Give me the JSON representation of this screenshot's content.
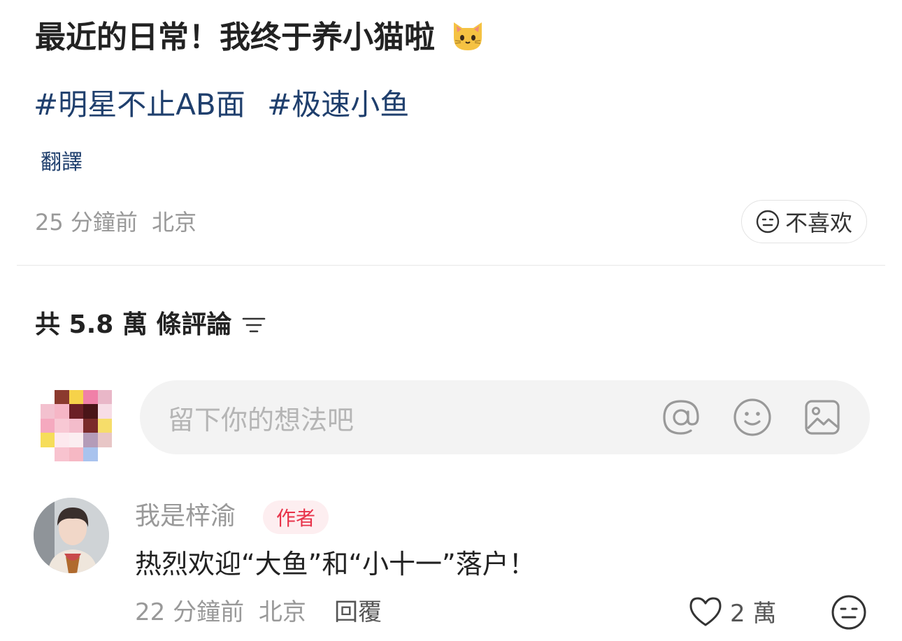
{
  "post": {
    "title": "最近的日常！我终于养小猫啦",
    "title_emoji": "cat-face-icon",
    "tags": [
      "#明星不止AB面",
      "#极速小鱼"
    ],
    "translate_label": "翻譯",
    "time": "25 分鐘前",
    "location": "北京",
    "dislike_label": "不喜欢"
  },
  "comments_header": {
    "label": "共 5.8 萬 條評論",
    "sort_icon": "sort-filter-icon"
  },
  "comment_input": {
    "placeholder": "留下你的想法吧",
    "icons": [
      "at-icon",
      "emoji-icon",
      "image-icon"
    ]
  },
  "comments": [
    {
      "author": "我是梓渝",
      "badge": "作者",
      "text": "热烈欢迎“大鱼”和“小十一”落户！",
      "time": "22 分鐘前",
      "location": "北京",
      "reply_label": "回覆",
      "likes": "2 萬"
    }
  ],
  "colors": {
    "tag_link": "#1f3f6d",
    "badge_text": "#e8334a",
    "badge_bg": "#fdeef0",
    "muted": "#999999",
    "input_bg": "#f3f3f3"
  }
}
